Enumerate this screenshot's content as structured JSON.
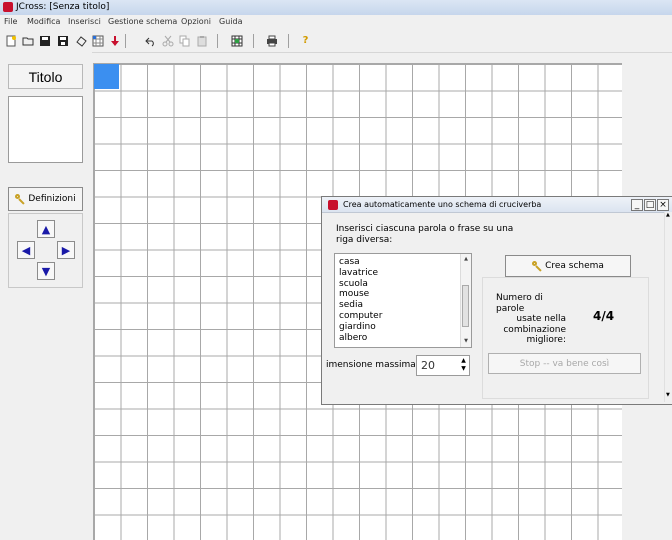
{
  "window": {
    "title": "JCross: [Senza titolo]"
  },
  "menu": [
    "File",
    "Modifica",
    "Inserisci",
    "Gestione schema",
    "Opzioni",
    "Guida"
  ],
  "toolbar": {
    "icons": [
      "new-icon",
      "open-icon",
      "save-icon",
      "save-as-icon",
      "erase-icon",
      "grid-icon",
      "download-icon",
      "undo-icon",
      "cut-icon",
      "copy-icon",
      "paste-icon",
      "generate-icon",
      "print-icon",
      "help-icon"
    ]
  },
  "left_panel": {
    "title_button": "Titolo",
    "definitions_button": "Definizioni",
    "arrows": [
      "up",
      "left",
      "right",
      "down"
    ]
  },
  "dialog": {
    "title": "Crea automaticamente uno schema di cruciverba",
    "instructions": "Inserisci ciascuna parola o frase su una riga diversa:",
    "words": [
      "casa",
      "lavatrice",
      "scuola",
      "mouse",
      "sedia",
      "computer",
      "giardino",
      "albero"
    ],
    "dimension_label": "imensione massima:",
    "dimension_value": "20",
    "create_button": "Crea schema",
    "count_label": [
      "Numero di parole",
      "usate nella",
      "combinazione",
      "migliore:"
    ],
    "count_value": "4/4",
    "stop_button": "Stop -- va bene così"
  },
  "colors": {
    "selection": "#3b8ff0",
    "arrow": "#1a1aa8",
    "app_red": "#c8102e"
  }
}
